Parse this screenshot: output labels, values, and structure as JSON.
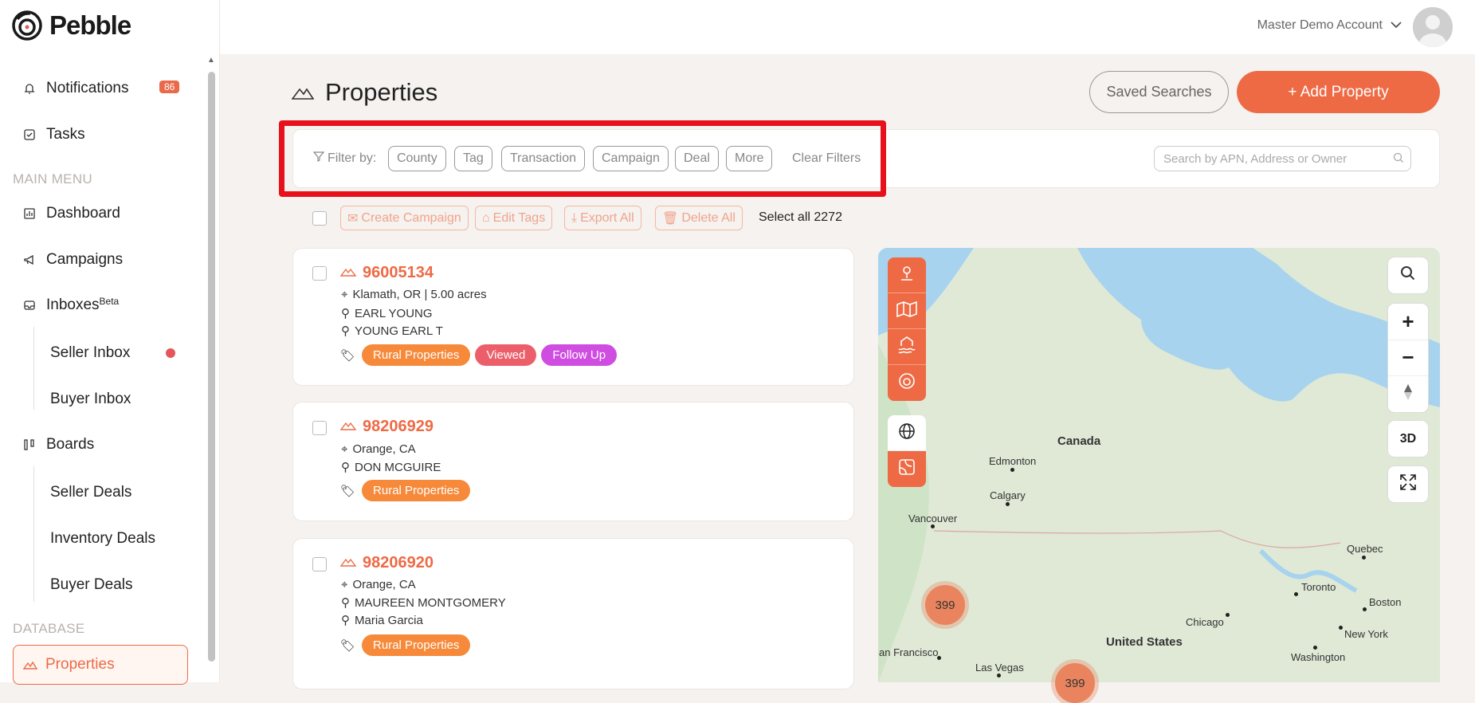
{
  "brand": {
    "name": "Pebble"
  },
  "sidebar": {
    "notifications": {
      "label": "Notifications",
      "badge": "86"
    },
    "tasks": {
      "label": "Tasks"
    },
    "main_menu_label": "MAIN MENU",
    "dashboard": "Dashboard",
    "campaigns": "Campaigns",
    "inboxes": {
      "label": "Inboxes",
      "sup": "Beta"
    },
    "seller_inbox": "Seller Inbox",
    "buyer_inbox": "Buyer Inbox",
    "boards": "Boards",
    "seller_deals": "Seller Deals",
    "inventory_deals": "Inventory Deals",
    "buyer_deals": "Buyer Deals",
    "database_label": "DATABASE",
    "properties": "Properties"
  },
  "header": {
    "account": "Master Demo Account"
  },
  "page": {
    "title": "Properties",
    "saved_searches": "Saved Searches",
    "add_property": "+ Add Property"
  },
  "filters": {
    "label": "Filter by:",
    "chips": [
      "County",
      "Tag",
      "Transaction",
      "Campaign",
      "Deal",
      "More"
    ],
    "clear": "Clear Filters",
    "search_placeholder": "Search by APN, Address or Owner"
  },
  "bulk": {
    "create_campaign": "Create Campaign",
    "edit_tags": "Edit Tags",
    "export_all": "Export All",
    "delete_all": "Delete All",
    "select_all": "Select all 2272"
  },
  "properties": [
    {
      "apn": "96005134",
      "location": "Klamath, OR | 5.00 acres",
      "owners": [
        "EARL YOUNG",
        "YOUNG EARL T"
      ],
      "tags": [
        "Rural Properties",
        "Viewed",
        "Follow Up"
      ]
    },
    {
      "apn": "98206929",
      "location": "Orange, CA",
      "owners": [
        "DON MCGUIRE"
      ],
      "tags": [
        "Rural Properties"
      ]
    },
    {
      "apn": "98206920",
      "location": "Orange, CA",
      "owners": [
        "MAUREEN MONTGOMERY",
        "Maria Garcia"
      ],
      "tags": [
        "Rural Properties"
      ]
    }
  ],
  "tag_colors": {
    "Rural Properties": "#f6893a",
    "Viewed": "#ec5f6a",
    "Follow Up": "#cf4de0"
  },
  "map": {
    "btn_3d": "3D",
    "countries": {
      "canada": "Canada",
      "us": "United States"
    },
    "cities": {
      "edmonton": "Edmonton",
      "calgary": "Calgary",
      "vancouver": "Vancouver",
      "quebec": "Quebec",
      "toronto": "Toronto",
      "boston": "Boston",
      "chicago": "Chicago",
      "newyork": "New York",
      "washington": "Washington",
      "sanfrancisco": "an Francisco",
      "lasvegas": "Las Vegas"
    },
    "clusters": [
      "399",
      "399"
    ]
  },
  "accent": "#ee6a45"
}
